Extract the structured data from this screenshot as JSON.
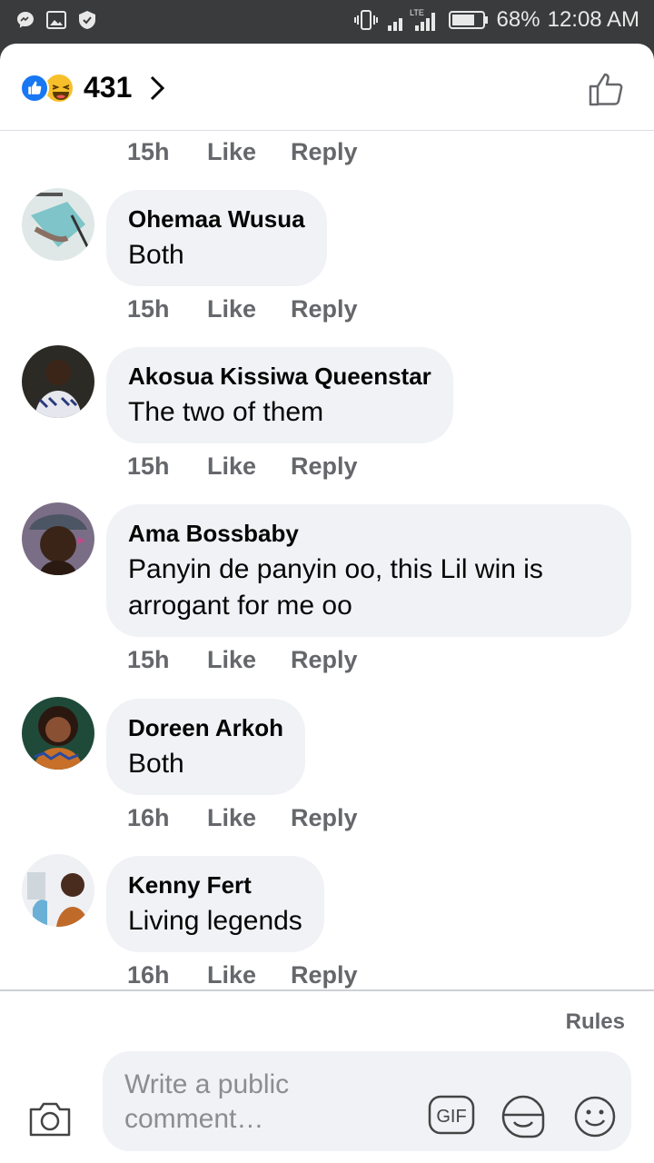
{
  "status_bar": {
    "network": "LTE",
    "battery": "68%",
    "time": "12:08 AM",
    "icons": [
      "messenger-icon",
      "gallery-icon",
      "shield-icon",
      "vibrate-icon",
      "signal-icon",
      "battery-icon"
    ]
  },
  "reactions": {
    "count": "431",
    "types": [
      "like",
      "haha"
    ],
    "accent": "#1877f2"
  },
  "comments": [
    {
      "time": "15h",
      "like": "Like",
      "reply": "Reply"
    },
    {
      "name": "Ohemaa Wusua",
      "text": "Both",
      "time": "15h",
      "like": "Like",
      "reply": "Reply"
    },
    {
      "name": "Akosua Kissiwa Queenstar",
      "text": "The two of them",
      "time": "15h",
      "like": "Like",
      "reply": "Reply"
    },
    {
      "name": "Ama Bossbaby",
      "text": "Panyin de panyin oo, this Lil win is arrogant for me oo",
      "time": "15h",
      "like": "Like",
      "reply": "Reply"
    },
    {
      "name": "Doreen Arkoh",
      "text": "Both",
      "time": "16h",
      "like": "Like",
      "reply": "Reply"
    },
    {
      "name": "Kenny Fert",
      "text": "Living legends",
      "time": "16h",
      "like": "Like",
      "reply": "Reply"
    }
  ],
  "composer": {
    "rules": "Rules",
    "placeholder": "Write a public comment…"
  }
}
